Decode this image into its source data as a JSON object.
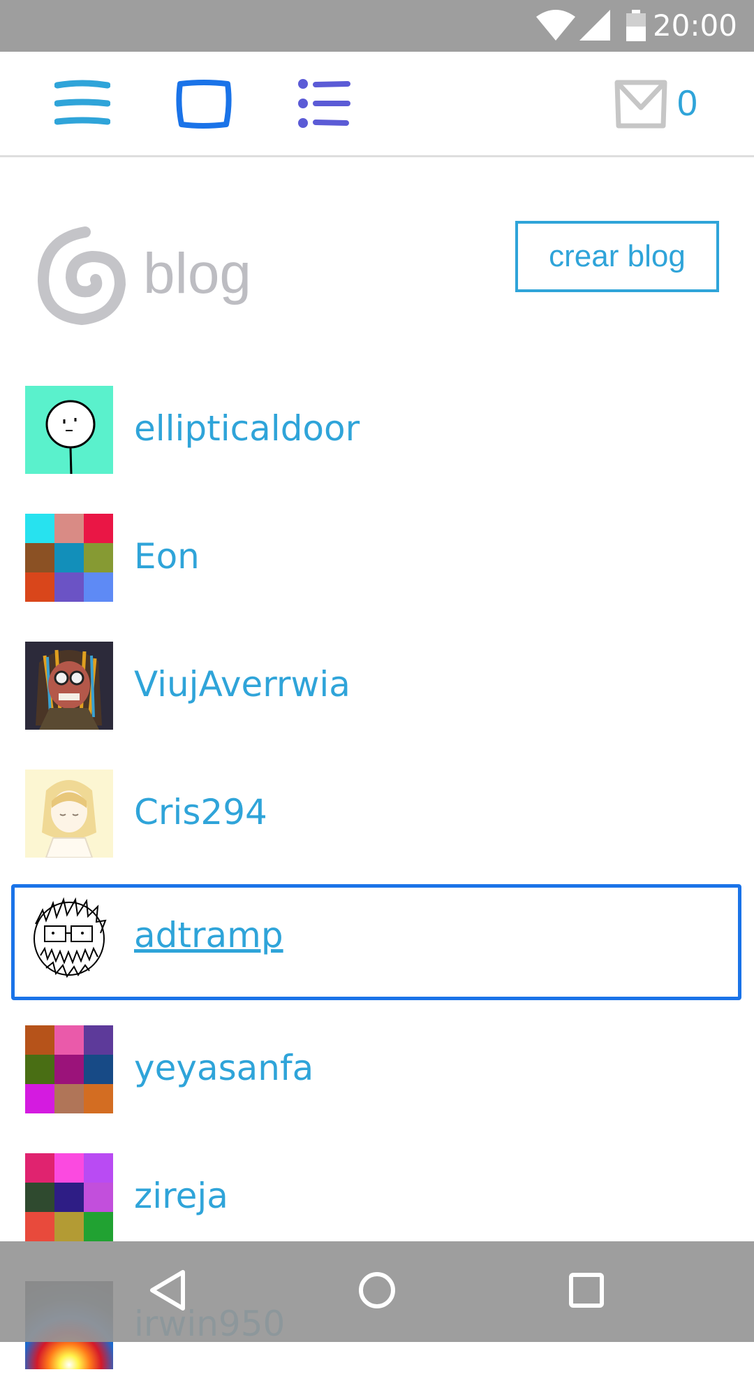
{
  "status_bar": {
    "time": "20:00",
    "icons": [
      "wifi-icon",
      "cell-signal-icon",
      "battery-icon"
    ]
  },
  "toolbar": {
    "menu_icon": "menu-icon",
    "window_icon": "square-icon",
    "list_icon": "list-icon",
    "mail_icon": "mail-icon",
    "mail_count": "0"
  },
  "header": {
    "logo_text": "blog",
    "create_button_label": "crear blog"
  },
  "blogs": [
    {
      "name": "ellipticaldoor",
      "avatar": "face-drawing"
    },
    {
      "name": "Eon",
      "avatar": "color-grid",
      "colors": [
        "#27e2ef",
        "#d98b85",
        "#ea1645",
        "#8b5124",
        "#128fba",
        "#869a33",
        "#d9461b",
        "#6b53c5",
        "#5e8af5"
      ]
    },
    {
      "name": "ViujAverrwia",
      "avatar": "photo"
    },
    {
      "name": "Cris294",
      "avatar": "anime-girl"
    },
    {
      "name": "adtramp",
      "avatar": "scribble-face",
      "focused": true
    },
    {
      "name": "yeyasanfa",
      "avatar": "color-grid",
      "colors": [
        "#b6531a",
        "#ea5aaa",
        "#5d3a9a",
        "#496e14",
        "#9b137a",
        "#174a86",
        "#d41be0",
        "#b07558",
        "#d36d22"
      ]
    },
    {
      "name": "zireja",
      "avatar": "color-grid",
      "colors": [
        "#e0236f",
        "#fb4ae0",
        "#b94bf3",
        "#2f4a2f",
        "#2e1d85",
        "#c24fdc",
        "#e84a3c",
        "#b39b34",
        "#21a232"
      ]
    },
    {
      "name": "irwin950",
      "avatar": "burst-photo"
    }
  ],
  "nav_bar": {
    "icons": [
      "back-icon",
      "home-icon",
      "recents-icon"
    ]
  }
}
